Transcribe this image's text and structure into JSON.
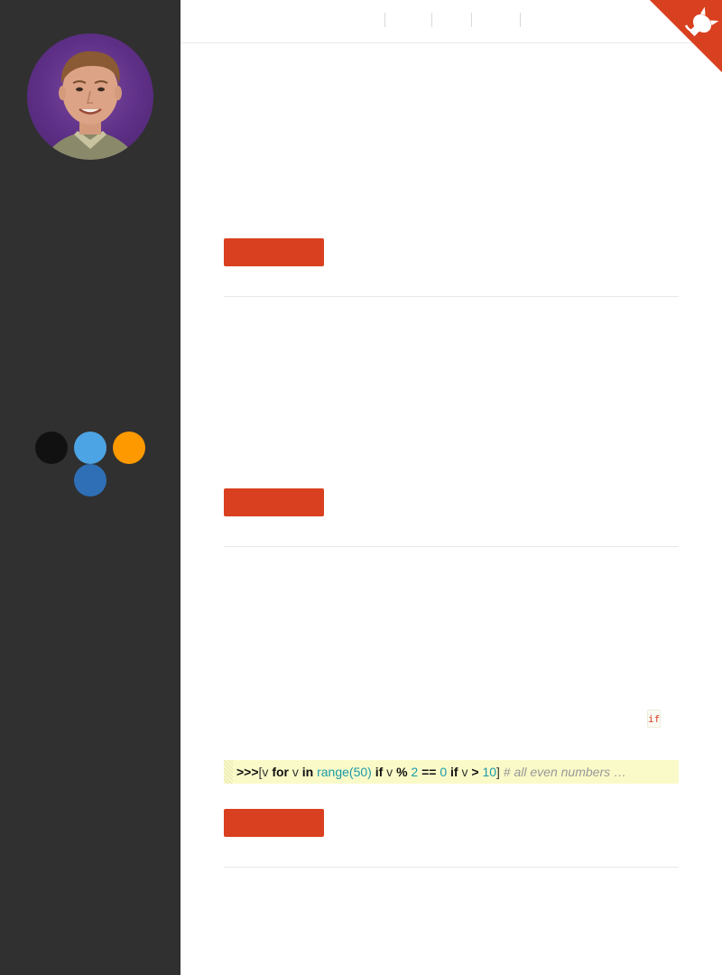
{
  "sidebar": {
    "profile_alt": "Profile photo",
    "social": [
      {
        "name": "github-icon",
        "color": "#111111"
      },
      {
        "name": "twitter-icon",
        "color": "#4ca4e4"
      },
      {
        "name": "rss-icon",
        "color": "#ff9900"
      },
      {
        "name": "linkedin-icon",
        "color": "#2e6fb6"
      }
    ]
  },
  "topnav": {
    "links": [
      "",
      "",
      "",
      ""
    ]
  },
  "colors": {
    "accent": "#d9401f",
    "sidebar_bg": "#303030",
    "code_bg": "#fafac8"
  },
  "posts": [
    {
      "read_more_label": ""
    },
    {
      "read_more_label": ""
    },
    {
      "inline_code": "if",
      "read_more_label": "",
      "code": {
        "prompt": ">>>",
        "open": "[v ",
        "kw_for": "for",
        "var1": " v ",
        "kw_in": "in",
        "fn_range": " range(",
        "num_50": "50",
        "close_paren": ") ",
        "kw_if1": "if",
        "var2": " v ",
        "op_mod": "%",
        "num_2": " 2 ",
        "op_eq": "==",
        "num_0": " 0 ",
        "kw_if2": "if",
        "var3": " v ",
        "op_gt": ">",
        "num_10": " 10",
        "close_bracket": "]",
        "comment": "  # all even numbers …"
      }
    }
  ]
}
